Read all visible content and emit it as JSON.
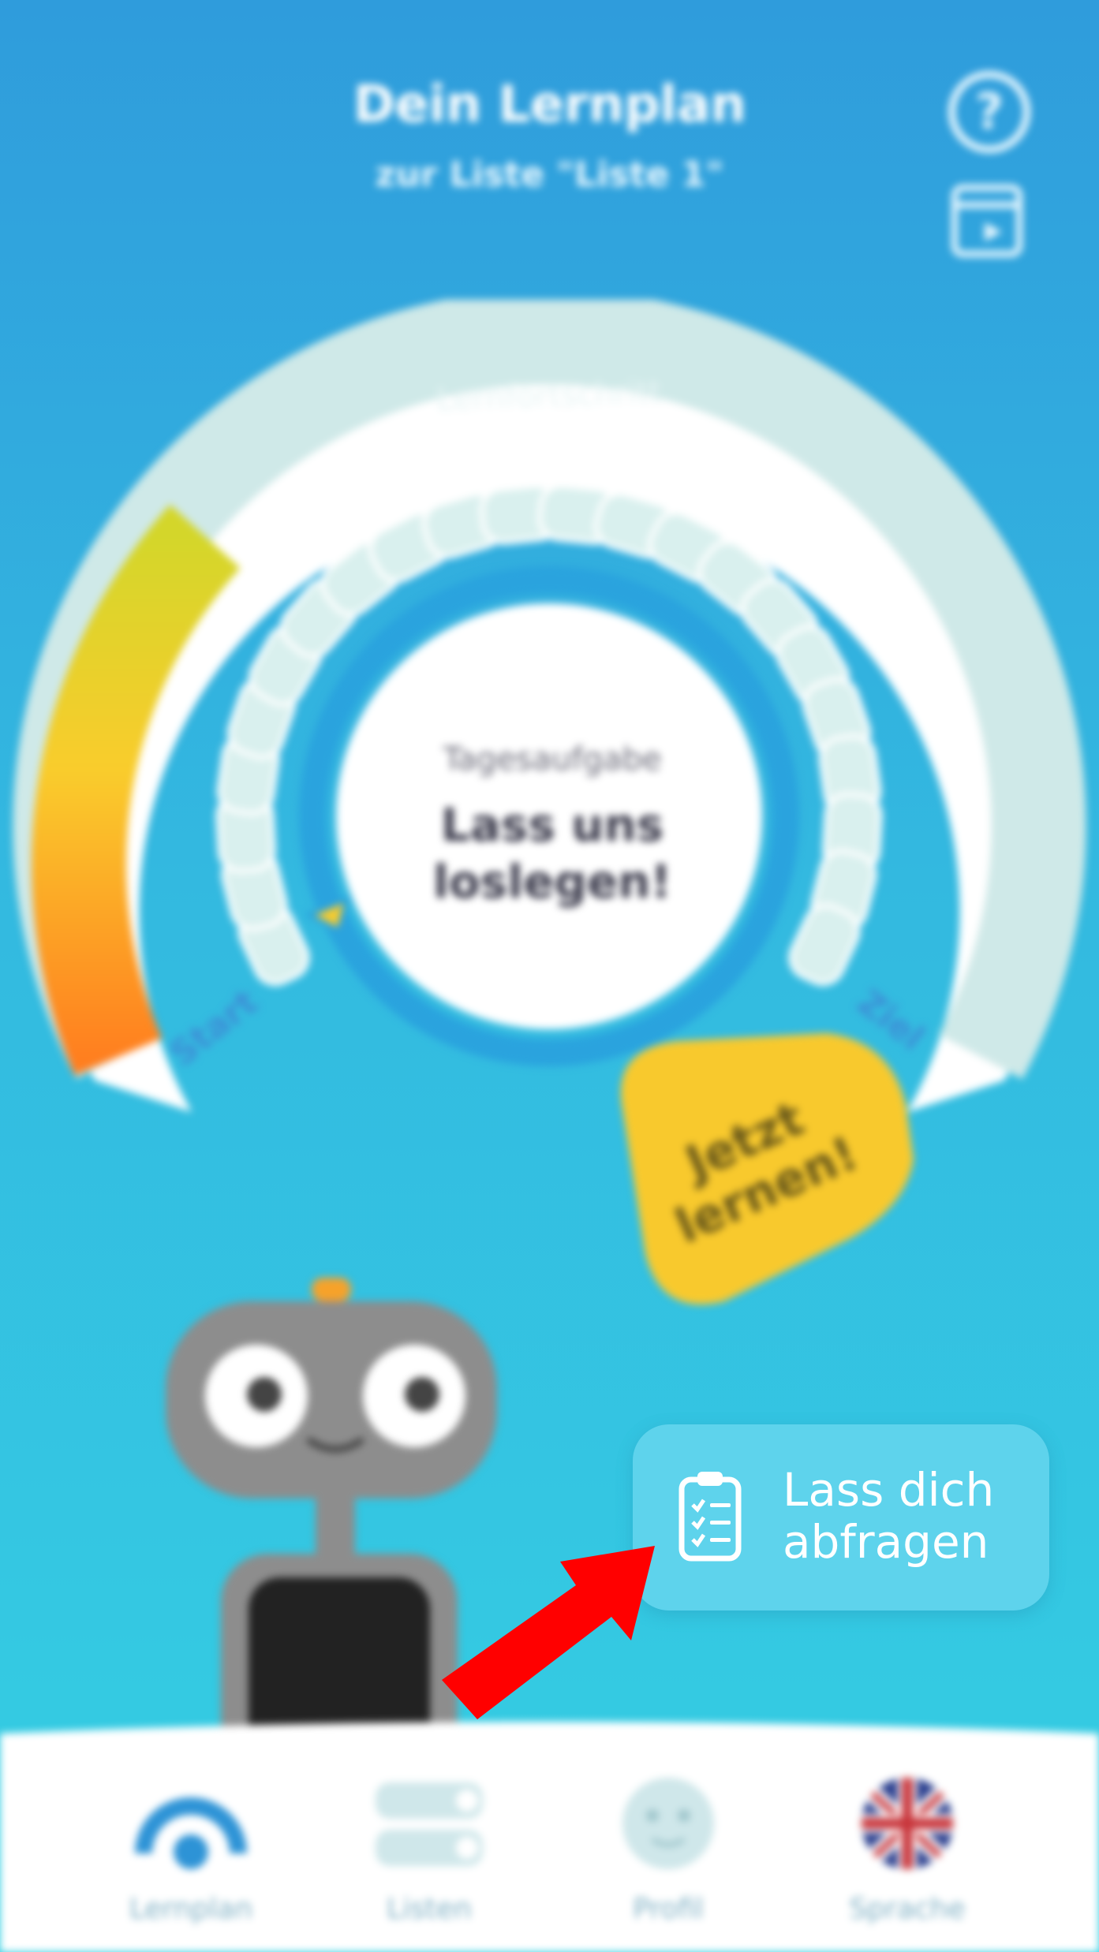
{
  "header": {
    "title": "Dein Lernplan",
    "subtitle": "zur Liste \"Liste 1\"",
    "help_icon": "help-circle-icon",
    "calendar_icon": "calendar-play-icon"
  },
  "gauge": {
    "arc_label": "Lernfortschritt",
    "start_label": "Start",
    "goal_label": "Ziel",
    "progress_fraction": 0.12,
    "segments_total": 22,
    "colors": {
      "progress_start": "#ff7f1f",
      "progress_mid": "#f9cc2c",
      "progress_end": "#d4d62a",
      "track": "#cfe9e8",
      "ring": "#2aa3de"
    }
  },
  "center": {
    "caption": "Tagesaufgabe",
    "message": "Lass uns loslegen!"
  },
  "cta": {
    "label": "Jetzt lernen!",
    "color": "#f8c92d"
  },
  "quiz_button": {
    "label": "Lass dich abfragen",
    "icon": "clipboard-checklist-icon",
    "color": "#5ed3ec"
  },
  "annotation": {
    "arrow_color": "#ff0000",
    "icon": "red-arrow-icon"
  },
  "tabbar": {
    "items": [
      {
        "label": "Lernplan",
        "icon": "learning-plan-icon"
      },
      {
        "label": "Listen",
        "icon": "lists-icon"
      },
      {
        "label": "Profil",
        "icon": "profile-face-icon"
      },
      {
        "label": "Sprache",
        "icon": "uk-flag-icon"
      }
    ]
  }
}
